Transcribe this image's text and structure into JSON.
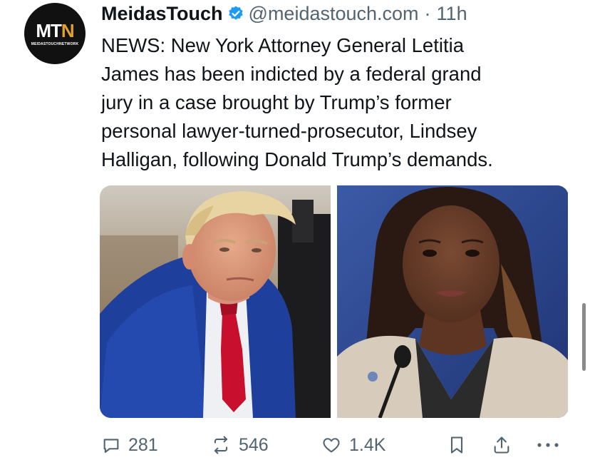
{
  "author": {
    "name": "MeidasTouch",
    "handle": "@meidastouch.com",
    "time": "11h",
    "avatar_mark_left": "MT",
    "avatar_mark_right": "N",
    "avatar_subtext": "MEIDASTOUCHNETWORK",
    "verified_color": "#1d9bf0"
  },
  "post": {
    "lines": [
      "NEWS: New York Attorney General Letitia",
      "James has been indicted by a federal grand",
      "jury in a case brought by Trump’s former",
      "personal lawyer-turned-prosecutor, Lindsey",
      "Halligan, following Donald Trump’s demands."
    ]
  },
  "media": {
    "images": [
      {
        "subject": "man in blue suit and red tie, seated"
      },
      {
        "subject": "woman speaking at a microphone, beige blazer"
      }
    ]
  },
  "actions": {
    "replies": "281",
    "reposts": "546",
    "likes": "1.4K"
  },
  "colors": {
    "text": "#0f1419",
    "secondary": "#536471",
    "accent": "#1d9bf0"
  }
}
